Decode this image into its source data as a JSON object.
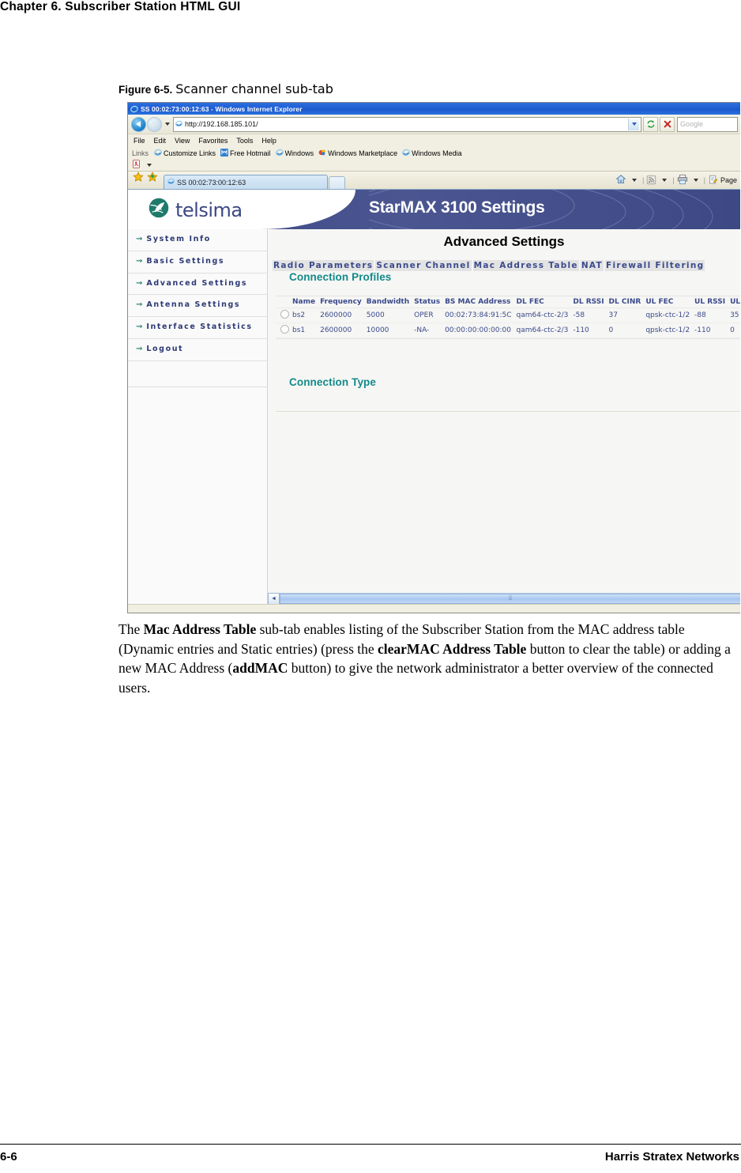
{
  "document": {
    "chapter_header": "Chapter 6.  Subscriber Station HTML GUI",
    "figure_number": "Figure 6-5.",
    "figure_title": "Scanner channel sub-tab",
    "body_paragraph": {
      "p1": "The ",
      "b1": "Mac Address Table",
      "p2": " sub-tab enables listing of the Subscriber Station from the MAC address table (Dynamic entries and Static entries) (press the ",
      "b2": "clearMAC Address Table",
      "p3": " button to clear the table) or adding a new MAC Address (",
      "b3": "addMAC",
      "p4": " button) to give the network administrator a better overview of the connected users."
    },
    "footer_page": "6-6",
    "footer_company": "Harris Stratex Networks"
  },
  "browser": {
    "window_title": "SS 00:02:73:00:12:63 - Windows Internet Explorer",
    "address": {
      "url": "http://192.168.185.101/",
      "refresh_icon": "refresh-icon",
      "stop_icon": "stop-icon",
      "search_placeholder": "Google"
    },
    "menu_items": [
      "File",
      "Edit",
      "View",
      "Favorites",
      "Tools",
      "Help"
    ],
    "links_bar": {
      "label": "Links",
      "items": [
        "Customize Links",
        "Free Hotmail",
        "Windows",
        "Windows Marketplace",
        "Windows Media"
      ]
    },
    "tab": {
      "title": "SS 00:02:73:00:12:63"
    },
    "toolbar_right": {
      "home_icon": "home-icon",
      "feeds_icon": "rss-feed-icon",
      "print_icon": "printer-icon",
      "page_label": "Page"
    }
  },
  "webapp": {
    "brand": "telsima",
    "banner_title": "StarMAX 3100 Settings",
    "page_title": "Advanced Settings",
    "sidebar": {
      "items": [
        {
          "label": "System Info"
        },
        {
          "label": "Basic Settings"
        },
        {
          "label": "Advanced Settings"
        },
        {
          "label": "Antenna Settings"
        },
        {
          "label": "Interface Statistics"
        },
        {
          "label": "Logout"
        }
      ]
    },
    "subtabs": [
      {
        "label": "Radio Parameters"
      },
      {
        "label": "Scanner Channel"
      },
      {
        "label": "Mac Address Table"
      },
      {
        "label": "NAT"
      },
      {
        "label": "Firewall Filtering"
      }
    ],
    "sections": {
      "connection_profiles": "Connection Profiles",
      "connection_type": "Connection Type"
    },
    "profiles_table": {
      "columns": [
        "",
        "Name",
        "Frequency",
        "Bandwidth",
        "Status",
        "BS MAC Address",
        "DL FEC",
        "DL RSSI",
        "DL CINR",
        "UL FEC",
        "UL RSSI",
        "UL CINR"
      ],
      "rows": [
        {
          "selected": "radio-unselected",
          "name": "bs2",
          "frequency": "2600000",
          "bandwidth": "5000",
          "status": "OPER",
          "bs_mac_address": "00:02:73:84:91:5C",
          "dl_fec": "qam64-ctc-2/3",
          "dl_rssi": "-58",
          "dl_cinr": "37",
          "ul_fec": "qpsk-ctc-1/2",
          "ul_rssi": "-88",
          "ul_cinr": "35"
        },
        {
          "selected": "radio-unselected",
          "name": "bs1",
          "frequency": "2600000",
          "bandwidth": "10000",
          "status": "-NA-",
          "bs_mac_address": "00:00:00:00:00:00",
          "dl_fec": "qam64-ctc-2/3",
          "dl_rssi": "-110",
          "dl_cinr": "0",
          "ul_fec": "qpsk-ctc-1/2",
          "ul_rssi": "-110",
          "ul_cinr": "0"
        }
      ]
    }
  },
  "colors": {
    "brand_navy": "#3d4884",
    "banner_gradient_start": "#3a4682",
    "teal_heading": "#128a8a",
    "subtab_text": "#3b4a8c",
    "titlebar_blue": "#1f5fd6"
  }
}
